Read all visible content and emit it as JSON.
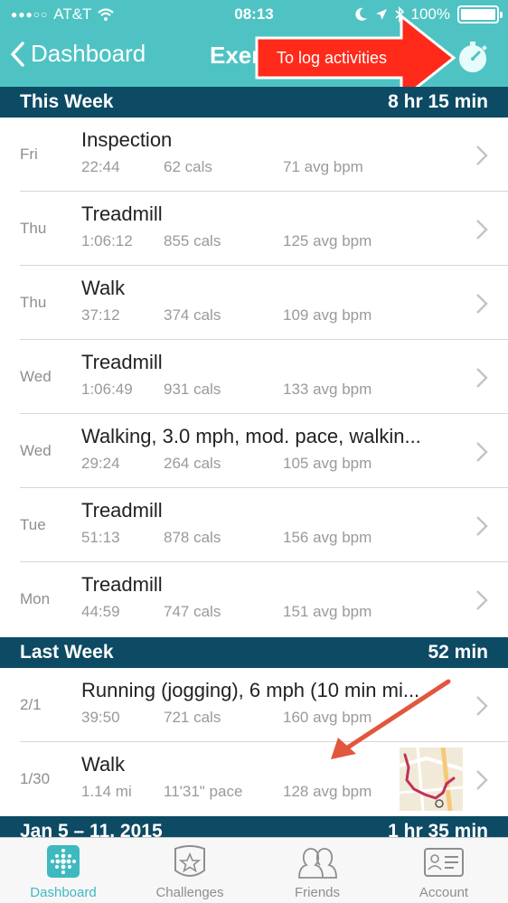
{
  "status_bar": {
    "carrier": "AT&T",
    "time": "08:13",
    "battery": "100%"
  },
  "nav": {
    "back_label": "Dashboard",
    "title_partial": "Exer"
  },
  "annotation": {
    "callout_text": "To log activities"
  },
  "sections": [
    {
      "label": "This Week",
      "total": "8 hr 15 min",
      "rows": [
        {
          "day": "Fri",
          "name": "Inspection",
          "stat1": "22:44",
          "stat2": "62 cals",
          "stat3": "71 avg bpm"
        },
        {
          "day": "Thu",
          "name": "Treadmill",
          "stat1": "1:06:12",
          "stat2": "855 cals",
          "stat3": "125 avg bpm"
        },
        {
          "day": "Thu",
          "name": "Walk",
          "stat1": "37:12",
          "stat2": "374 cals",
          "stat3": "109 avg bpm"
        },
        {
          "day": "Wed",
          "name": "Treadmill",
          "stat1": "1:06:49",
          "stat2": "931 cals",
          "stat3": "133 avg bpm"
        },
        {
          "day": "Wed",
          "name": "Walking, 3.0 mph, mod. pace, walkin...",
          "stat1": "29:24",
          "stat2": "264 cals",
          "stat3": "105 avg bpm"
        },
        {
          "day": "Tue",
          "name": "Treadmill",
          "stat1": "51:13",
          "stat2": "878 cals",
          "stat3": "156 avg bpm"
        },
        {
          "day": "Mon",
          "name": "Treadmill",
          "stat1": "44:59",
          "stat2": "747 cals",
          "stat3": "151 avg bpm"
        }
      ]
    },
    {
      "label": "Last Week",
      "total": "52 min",
      "rows": [
        {
          "day": "2/1",
          "name": "Running (jogging), 6 mph (10 min mi...",
          "stat1": "39:50",
          "stat2": "721 cals",
          "stat3": "160 avg bpm"
        },
        {
          "day": "1/30",
          "name": "Walk",
          "stat1": "1.14 mi",
          "stat2": "11'31\" pace",
          "stat3": "128 avg bpm"
        }
      ]
    },
    {
      "label": "Jan 5 – 11, 2015",
      "total": "1 hr 35 min"
    }
  ],
  "tabs": [
    {
      "label": "Dashboard",
      "icon": "dots-grid-icon",
      "active": true
    },
    {
      "label": "Challenges",
      "icon": "star-badge-icon",
      "active": false
    },
    {
      "label": "Friends",
      "icon": "friends-icon",
      "active": false
    },
    {
      "label": "Account",
      "icon": "id-card-icon",
      "active": false
    }
  ],
  "colors": {
    "header": "#4fc3c3",
    "section": "#0d4a63",
    "callout": "#ff2a1a",
    "active_tab": "#3fb9c0"
  }
}
